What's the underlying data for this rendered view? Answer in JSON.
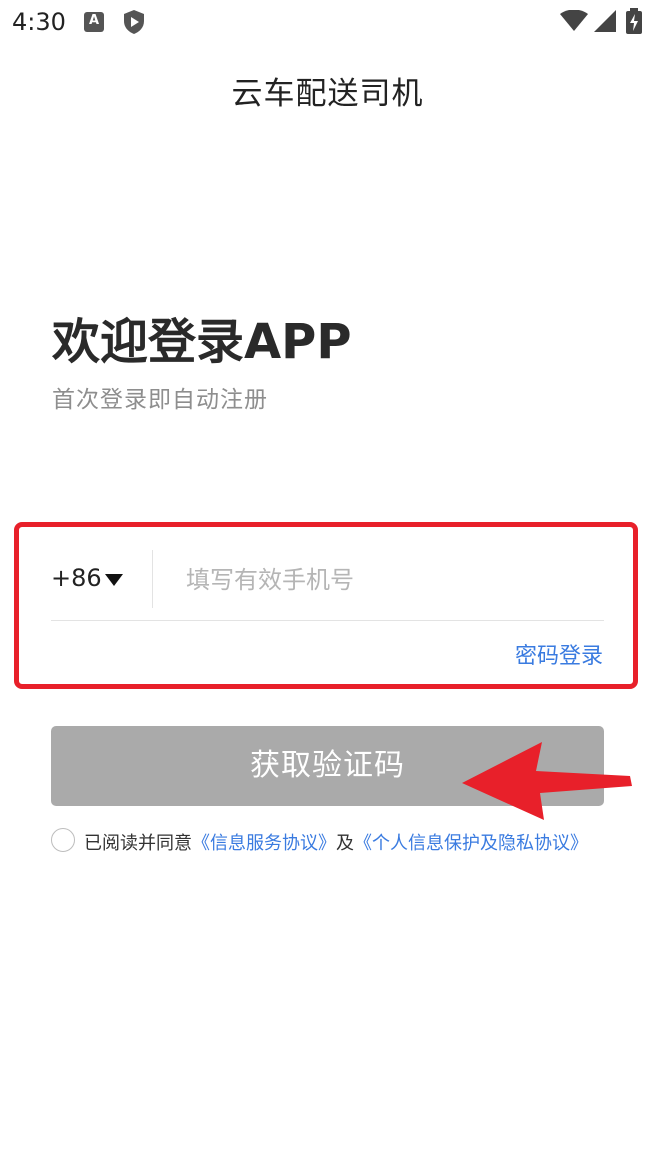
{
  "status_bar": {
    "time": "4:30",
    "a_badge": "A"
  },
  "header": {
    "title": "云车配送司机"
  },
  "welcome": {
    "title": "欢迎登录APP",
    "subtitle": "首次登录即自动注册"
  },
  "form": {
    "country_code": "+86",
    "phone_placeholder": "填写有效手机号",
    "phone_value": "",
    "password_login_label": "密码登录",
    "submit_label": "获取验证码"
  },
  "agreement": {
    "prefix": "已阅读并同意",
    "service_link": "《信息服务协议》",
    "conjunction": "及",
    "privacy_link": "《个人信息保护及隐私协议》",
    "checked": false
  },
  "colors": {
    "accent_link": "#3a7be0",
    "button_disabled": "#aaaaaa",
    "annotation_red": "#e8202a"
  },
  "icons": {
    "status": [
      "text-a-icon",
      "play-shield-icon",
      "wifi-icon",
      "signal-icon",
      "battery-icon"
    ],
    "dropdown": "caret-down-icon",
    "annotation": "arrow-left-icon"
  }
}
